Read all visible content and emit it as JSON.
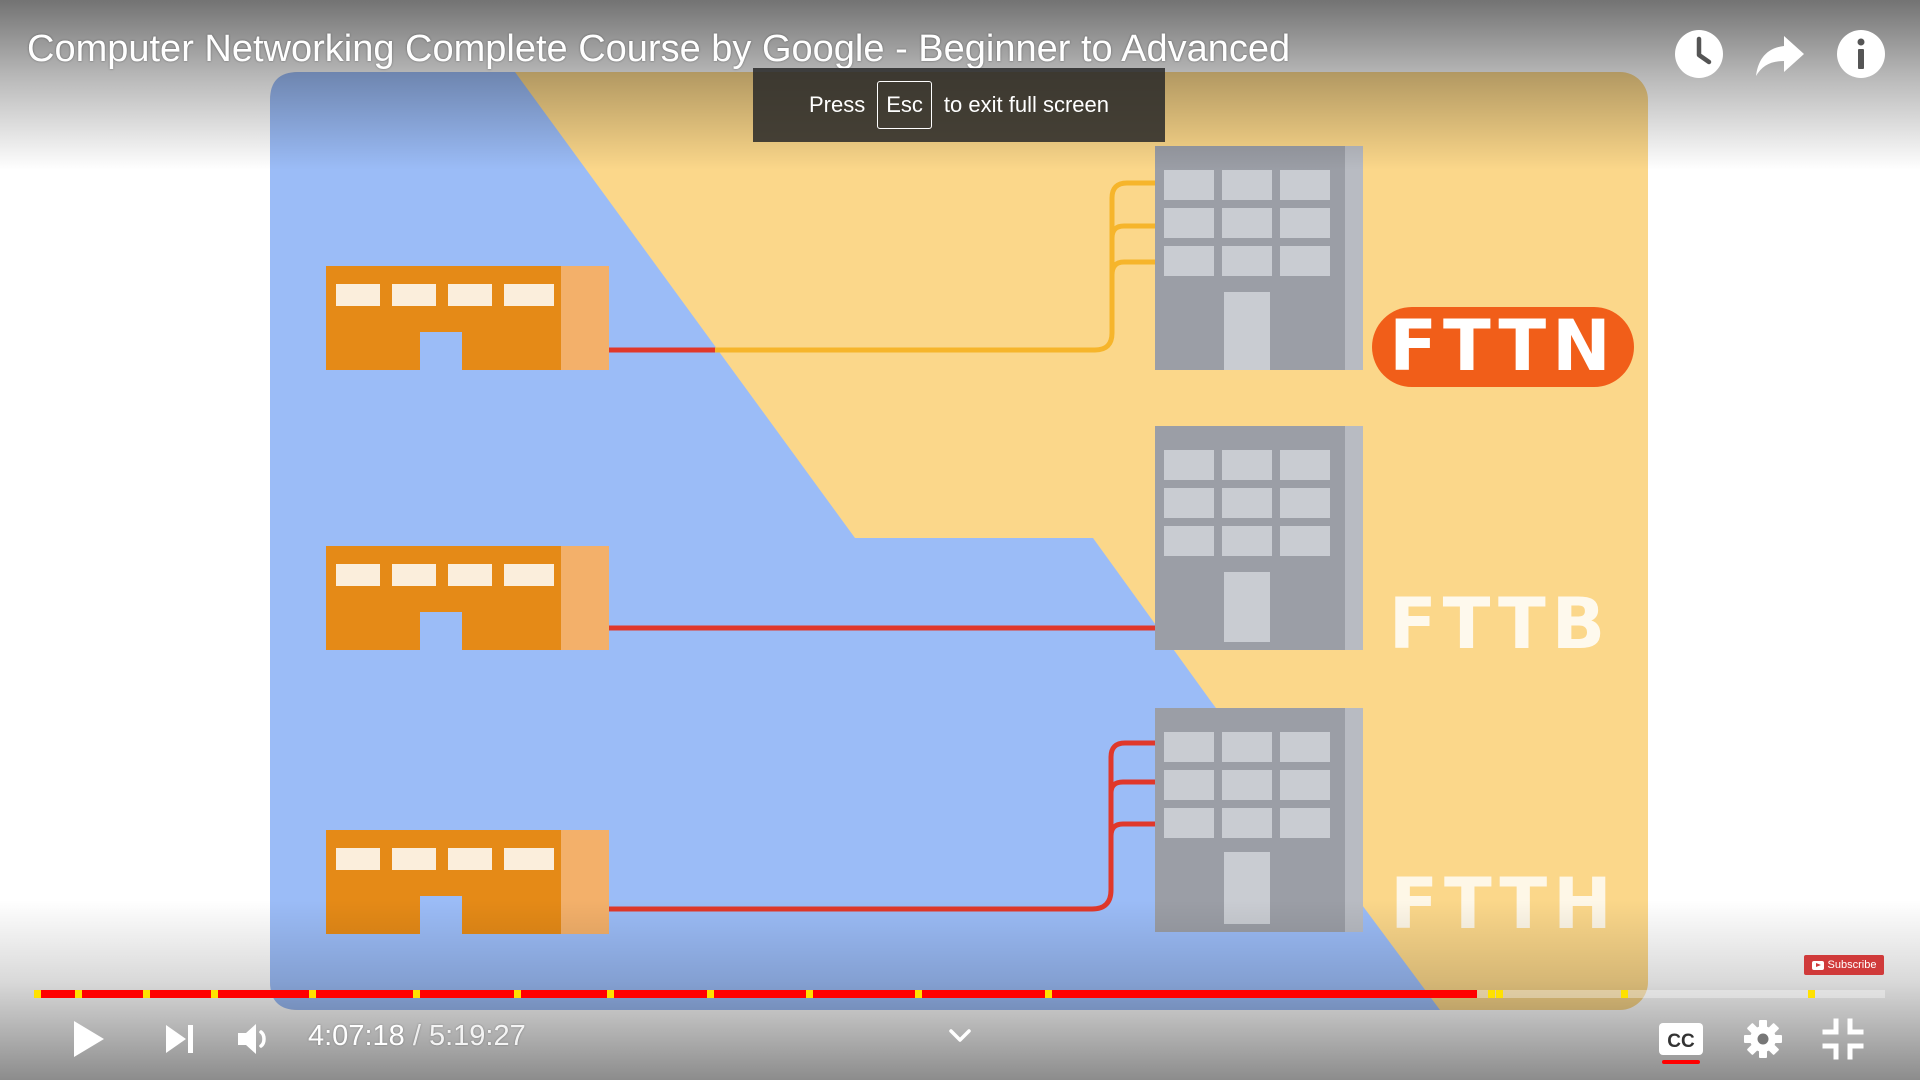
{
  "player": {
    "title": "Computer Networking Complete Course by Google - Beginner to Advanced",
    "top_icons": {
      "watch_later": "clock-icon",
      "share": "share-arrow-icon",
      "info": "info-icon"
    }
  },
  "toast": {
    "prefix": "Press",
    "key": "Esc",
    "suffix": "to exit full screen"
  },
  "video_content": {
    "labels": [
      "FTTN",
      "FTTB",
      "FTTH"
    ],
    "colors": {
      "blue_region": "#9bbcf7",
      "yellow_region": "#fbd78a",
      "house": "#e58a17",
      "house_side": "#f3b06a",
      "building": "#9b9ea6",
      "fiber_red": "#e0382b",
      "copper_yellow": "#f6b52b",
      "fttn_badge": "#f15e19"
    }
  },
  "watermark": {
    "label": "Subscribe"
  },
  "progress": {
    "played_fraction": 0.7794,
    "chapter_markers": [
      0.0,
      0.022,
      0.059,
      0.096,
      0.149,
      0.205,
      0.26,
      0.31,
      0.364,
      0.418,
      0.477,
      0.547,
      0.787,
      0.791,
      0.859,
      0.96
    ],
    "colors": {
      "played": "#ff0000",
      "marker": "#ffe100"
    }
  },
  "controls": {
    "current_time": "4:07:18",
    "separator": "/",
    "duration": "5:19:27",
    "icons": {
      "play": "play-icon",
      "next": "skip-next-icon",
      "volume": "volume-icon",
      "more": "chevron-down-icon",
      "captions": "cc-icon",
      "settings": "gear-icon",
      "exit_fullscreen": "exit-fullscreen-icon"
    },
    "captions_label": "CC"
  }
}
